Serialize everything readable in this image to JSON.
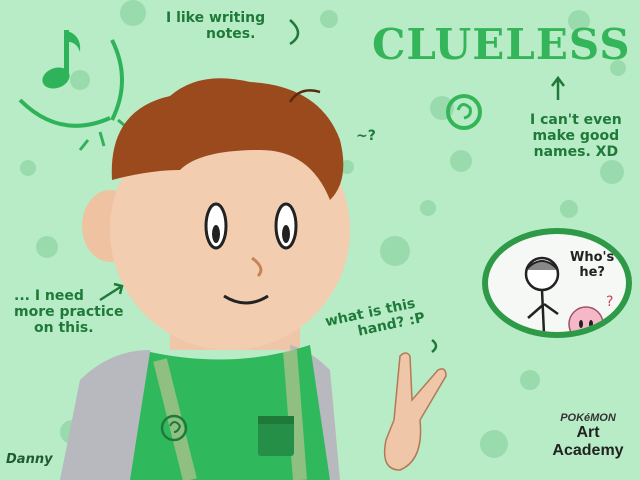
{
  "title": "CLUELESS",
  "notes": {
    "writing": [
      "I like writing",
      "notes."
    ],
    "names": [
      "I can't even",
      "make good",
      "names. XD"
    ],
    "practice": [
      "... I need",
      "more practice",
      "on this."
    ],
    "hand": [
      "what is this",
      "hand? :P"
    ],
    "question": "~?"
  },
  "bubble_text": [
    "Who's",
    "he?"
  ],
  "signature": "Danny",
  "logo": {
    "top": "POKéMON",
    "bottom": "Art Academy"
  },
  "colors": {
    "background": "#b8ecc6",
    "accent": "#35b559",
    "text": "#1f7a3a"
  }
}
